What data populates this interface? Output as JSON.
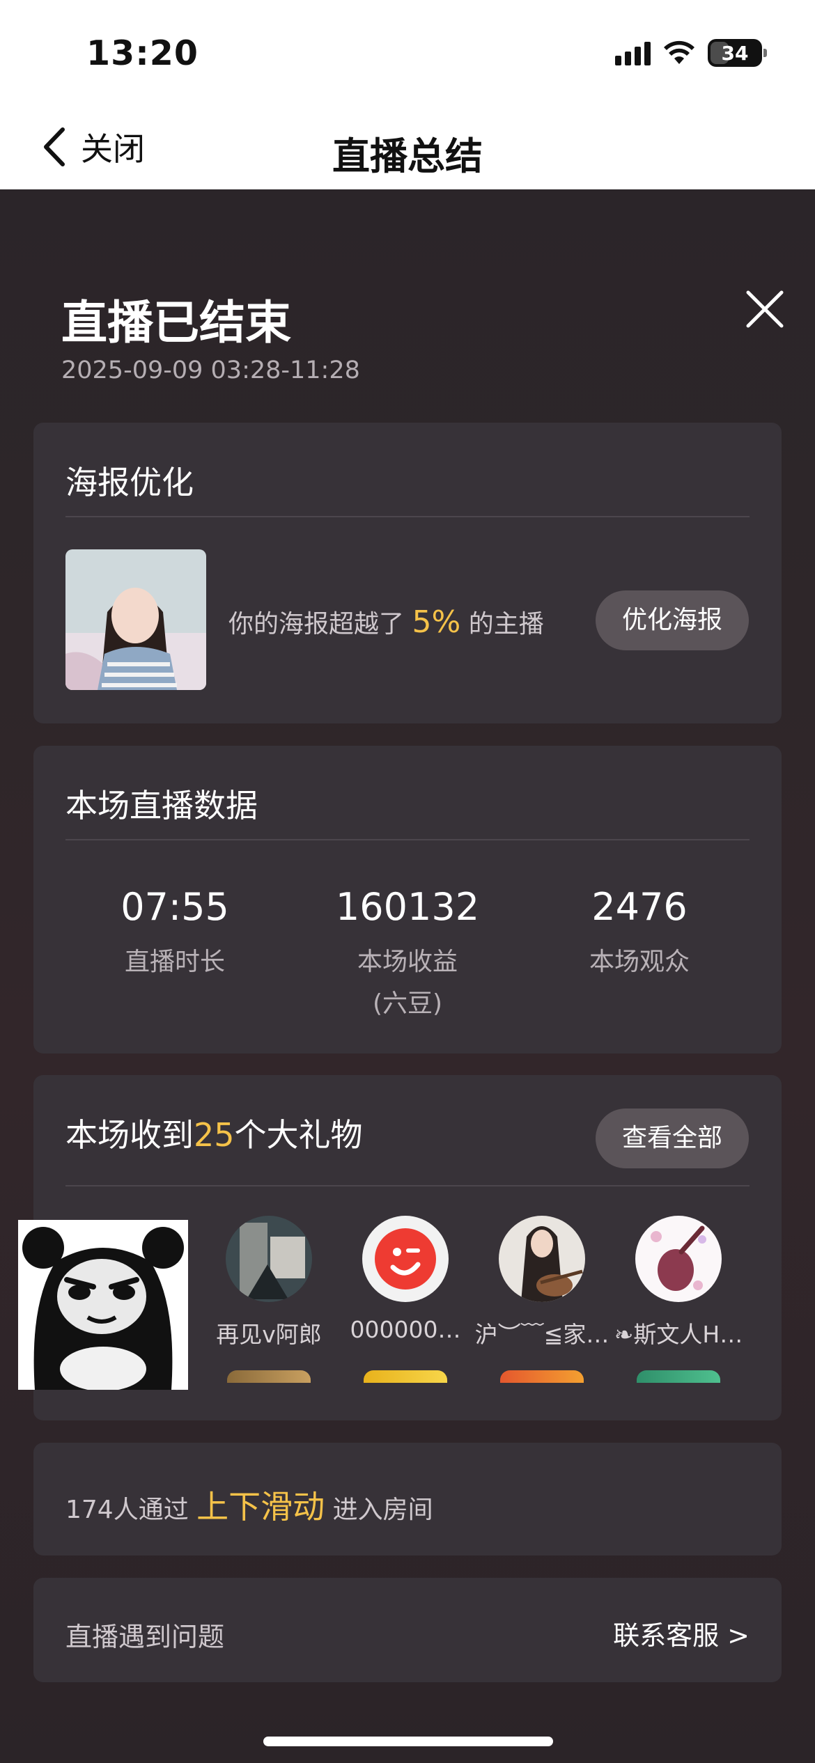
{
  "status_bar": {
    "time": "13:20",
    "battery": "34"
  },
  "nav": {
    "back_label": "关闭",
    "title": "直播总结"
  },
  "summary": {
    "title": "直播已结束",
    "time_range": "2025-09-09 03:28-11:28"
  },
  "poster_card": {
    "title": "海报优化",
    "text_before": "你的海报超越了",
    "percent": "5%",
    "text_after": "的主播",
    "button": "优化海报"
  },
  "stats_card": {
    "title": "本场直播数据",
    "stats": [
      {
        "value": "07:55",
        "label": "直播时长",
        "sub": ""
      },
      {
        "value": "160132",
        "label": "本场收益",
        "sub": "(六豆)"
      },
      {
        "value": "2476",
        "label": "本场观众",
        "sub": ""
      }
    ]
  },
  "gifts_card": {
    "title_before": "本场收到",
    "count": "25",
    "title_after": "个大礼物",
    "button": "查看全部",
    "gifts": [
      {
        "name": "再见v阿郎"
      },
      {
        "name": "000000…"
      },
      {
        "name": "沪︶﹋≦家…"
      },
      {
        "name": "❧斯文人H…"
      }
    ]
  },
  "slide_card": {
    "count_text": "174人通过",
    "highlight": "上下滑动",
    "suffix": "进入房间"
  },
  "help_card": {
    "label": "直播遇到问题",
    "link": "联系客服 >"
  },
  "colors": {
    "accent": "#f5c249",
    "card": "#373238",
    "pill": "#5b5459"
  }
}
